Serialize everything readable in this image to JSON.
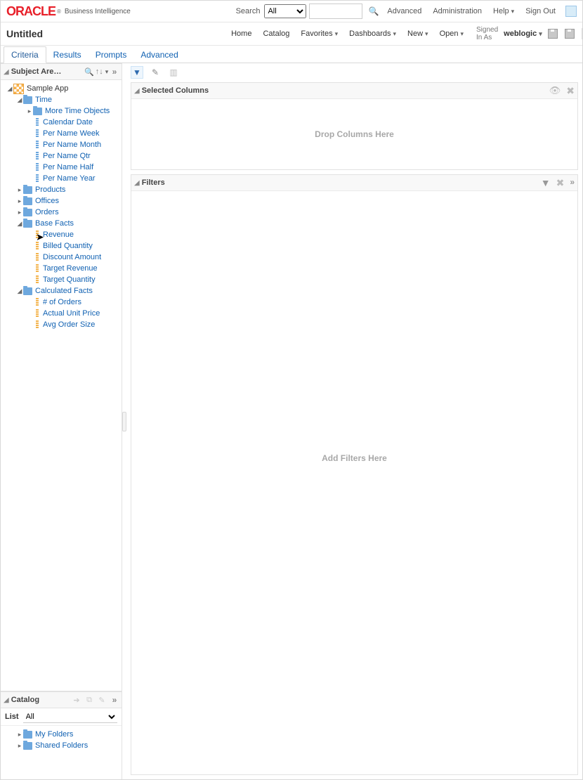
{
  "brand": {
    "name": "ORACLE",
    "suffix": "Business Intelligence"
  },
  "header": {
    "search_label": "Search",
    "search_scope": "All",
    "advanced": "Advanced",
    "administration": "Administration",
    "help": "Help",
    "sign_out": "Sign Out"
  },
  "nav": {
    "title": "Untitled",
    "home": "Home",
    "catalog": "Catalog",
    "favorites": "Favorites",
    "dashboards": "Dashboards",
    "new": "New",
    "open": "Open",
    "signed_in_as": "Signed In As",
    "user": "weblogic"
  },
  "tabs": {
    "criteria": "Criteria",
    "results": "Results",
    "prompts": "Prompts",
    "advanced": "Advanced"
  },
  "subject_area": {
    "title": "Subject Are…",
    "root": "Sample App",
    "time": {
      "label": "Time",
      "more": "More Time Objects",
      "items": [
        "Calendar Date",
        "Per Name Week",
        "Per Name Month",
        "Per Name Qtr",
        "Per Name Half",
        "Per Name Year"
      ]
    },
    "products": "Products",
    "offices": "Offices",
    "orders": "Orders",
    "base_facts": {
      "label": "Base Facts",
      "items": [
        "Revenue",
        "Billed Quantity",
        "Discount Amount",
        "Target Revenue",
        "Target Quantity"
      ]
    },
    "calc_facts": {
      "label": "Calculated Facts",
      "items": [
        "# of Orders",
        "Actual Unit Price",
        "Avg Order Size"
      ]
    }
  },
  "selected_columns": {
    "title": "Selected Columns",
    "placeholder": "Drop Columns Here"
  },
  "filters": {
    "title": "Filters",
    "placeholder": "Add Filters Here"
  },
  "catalog": {
    "title": "Catalog",
    "list_label": "List",
    "list_value": "All",
    "my_folders": "My Folders",
    "shared_folders": "Shared Folders"
  }
}
